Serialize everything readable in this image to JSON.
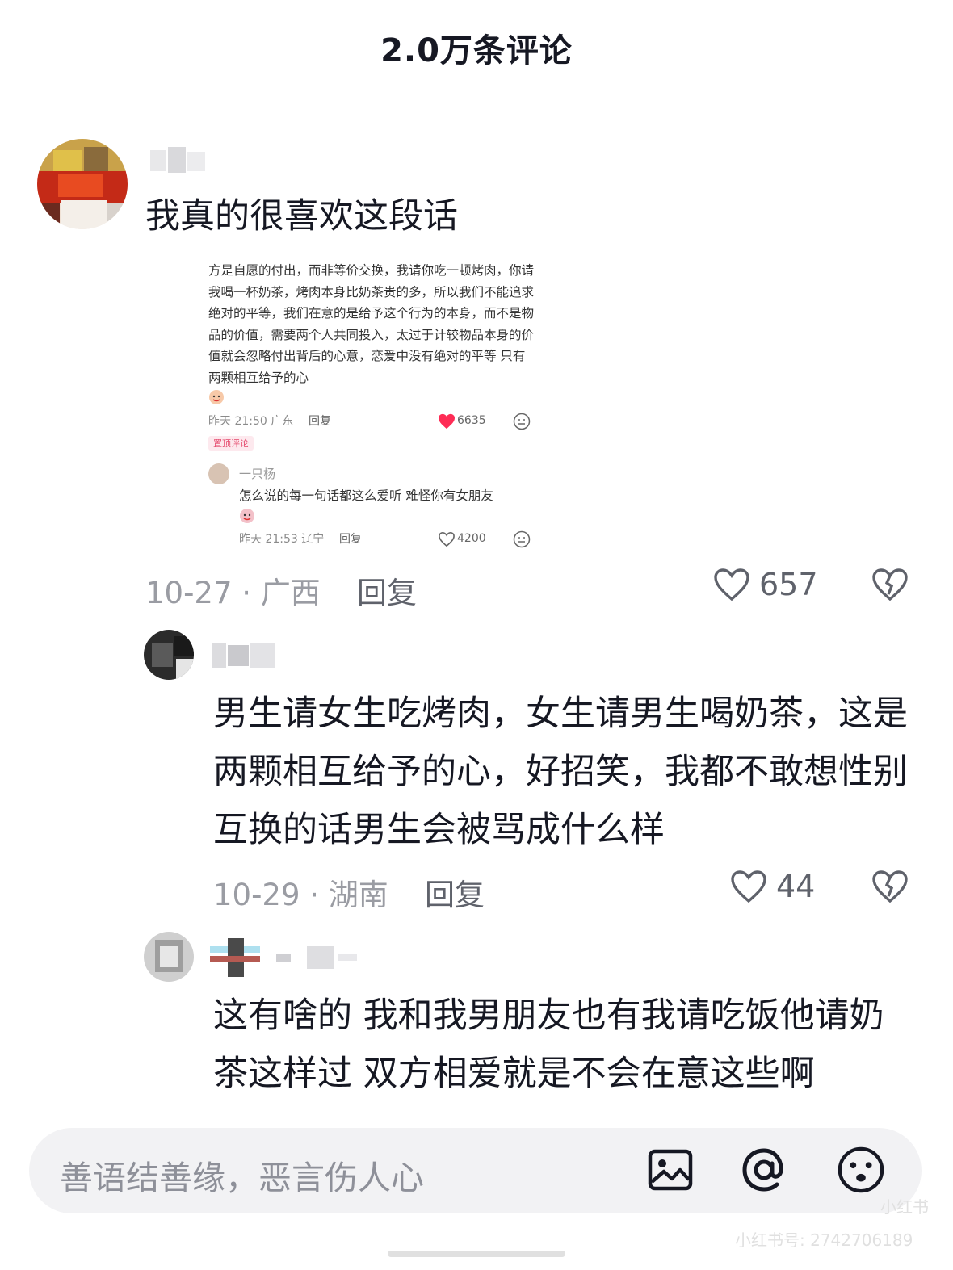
{
  "header": {
    "title": "2.0万条评论"
  },
  "comments": [
    {
      "text": "我真的很喜欢这段话",
      "date": "10-27",
      "location": "广西",
      "reply_label": "回复",
      "likes": "657",
      "embedded": {
        "paragraph": "方是自愿的付出，而非等价交换，我请你吃一顿烤肉，你请我喝一杯奶茶，烤肉本身比奶茶贵的多，所以我们不能追求绝对的平等，我们在意的是给予这个行为的本身，而不是物品的价值，需要两个人共同投入，太过于计较物品本身的价值就会忽略付出背后的心意，恋爱中没有绝对的平等 只有两颗相互给予的心",
        "meta1": "昨天 21:50 广东",
        "reply1": "回复",
        "likes1": "6635",
        "pinned": "置顶评论",
        "reply_user": "一只杨",
        "reply_text": "怎么说的每一句话都这么爱听 难怪你有女朋友",
        "meta2": "昨天 21:53 辽宁",
        "reply2": "回复",
        "likes2": "4200"
      }
    },
    {
      "text": "男生请女生吃烤肉，女生请男生喝奶茶，这是两颗相互给予的心，好招笑，我都不敢想性别互换的话男生会被骂成什么样",
      "date": "10-29",
      "location": "湖南",
      "reply_label": "回复",
      "likes": "44"
    },
    {
      "text": "这有啥的 我和我男朋友也有我请吃饭他请奶茶这样过  双方相爱就是不会在意这些啊"
    }
  ],
  "bottom": {
    "placeholder": "善语结善缘，恶言伤人心",
    "icons": [
      "image-icon",
      "at-icon",
      "emoji-icon"
    ]
  },
  "watermark": {
    "app": "小红书",
    "id": "小红书号: 2742706189"
  },
  "colors": {
    "like_red": "#fe2c55",
    "text": "#161823",
    "muted": "#9a9ca3"
  }
}
